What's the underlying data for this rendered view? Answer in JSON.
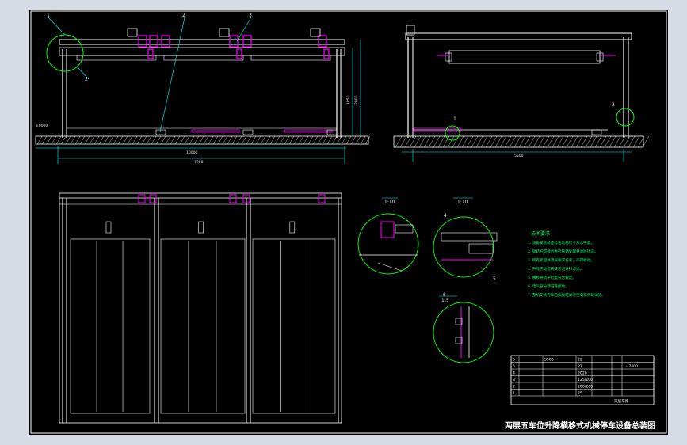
{
  "title": "两层五车位升降横移式机械停车设备总装图",
  "colors": {
    "background": "#000000",
    "frame": "#ffffff",
    "structure": "#ffffff",
    "hidden": "#ff00ff",
    "detail": "#00ff00",
    "note": "#00ff66",
    "dimension": "#00ffff",
    "leader": "#00ffff",
    "table": "#ffffff"
  },
  "callouts": {
    "c1": "1",
    "c2": "2",
    "c3": "3",
    "c4": "4",
    "c5": "5",
    "c6": "6"
  },
  "scales": {
    "s1": "1:10",
    "s2": "1:10",
    "s3": "1:5"
  },
  "dims": {
    "front_h1": "1850",
    "front_h2": "2000",
    "front_span1": "10000",
    "front_span2": "7200",
    "side_span": "5500",
    "left_ref": "±0000"
  },
  "notes": {
    "heading": "技术要求",
    "lines": [
      "1. 设备安装前应检查地基尺寸及水平度。",
      "2. 钢结构焊接后进行除锈处理并涂防锈漆。",
      "3. 所有紧固件须按要求拧紧，不得松动。",
      "4. 升降传动机构安装后进行调试。",
      "5. 横移导轨平行度符合规定。",
      "6. 电气部分须可靠接地。",
      "7. 整机安装完毕后按规范进行空载及负载试验。"
    ]
  },
  "table": {
    "rows": [
      [
        "6",
        "",
        "5500",
        "22",
        "",
        "",
        ""
      ],
      [
        "5",
        "",
        "",
        "21",
        "",
        "",
        "L=7400"
      ],
      [
        "4",
        "",
        "",
        "2020",
        "",
        "",
        ""
      ],
      [
        "3",
        "",
        "",
        "125/100",
        "",
        "",
        ""
      ],
      [
        "2",
        "",
        "",
        "200/200",
        "",
        "",
        ""
      ],
      [
        "1",
        "",
        "",
        "75",
        "",
        "",
        ""
      ]
    ],
    "footer": "双层车库"
  }
}
